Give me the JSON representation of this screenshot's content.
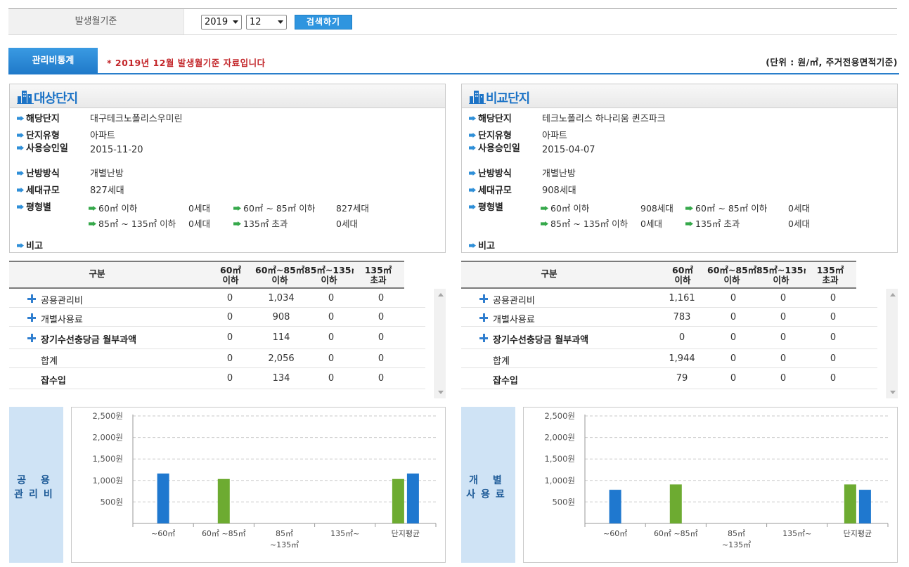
{
  "search": {
    "label": "발생월기준",
    "year": "2019",
    "month": "12",
    "button_label": "검색하기"
  },
  "stats": {
    "tab_label": "관리비통계",
    "notice": "* 2019년 12월 발생월기준 자료입니다",
    "unit": "(단위 : 원/㎡, 주거전용면적기준)"
  },
  "colors": {
    "accent": "#2f95df",
    "notice": "#c3262a",
    "bar_blue": "#1f78cf",
    "bar_green": "#6dab31"
  },
  "target": {
    "title": "대상단지",
    "rows": [
      {
        "key": "해당단지",
        "value": "대구테크노폴리스우미린"
      },
      {
        "key": "단지유형",
        "value": "아파트"
      },
      {
        "key": "사용승인일",
        "value": "2015-11-20"
      },
      {
        "key": "난방방식",
        "value": "개별난방"
      },
      {
        "key": "세대규모",
        "value": "827세대"
      }
    ],
    "size_key": "평형별",
    "sizes": [
      {
        "label": "60㎡ 이하",
        "count": "0세대"
      },
      {
        "label": "60㎡ ~ 85㎡ 이하",
        "count": "827세대"
      },
      {
        "label": "85㎡ ~ 135㎡ 이하",
        "count": "0세대"
      },
      {
        "label": "135㎡ 초과",
        "count": "0세대"
      }
    ],
    "note_key": "비고",
    "table": {
      "headers": [
        "구분",
        "60㎡\n이하",
        "60㎡~85㎡\n이하",
        "85㎡~135㎡\n이하",
        "135㎡\n초과"
      ],
      "rows": [
        {
          "label": "공용관리비",
          "plus": true,
          "values": [
            "0",
            "1,034",
            "0",
            "0"
          ]
        },
        {
          "label": "개별사용료",
          "plus": true,
          "values": [
            "0",
            "908",
            "0",
            "0"
          ]
        },
        {
          "label": "장기수선충당금 월부과액",
          "plus": true,
          "values": [
            "0",
            "114",
            "0",
            "0"
          ]
        },
        {
          "label": "합계",
          "plus": false,
          "values": [
            "0",
            "2,056",
            "0",
            "0"
          ]
        },
        {
          "label": "잡수입",
          "plus": false,
          "values": [
            "0",
            "134",
            "0",
            "0"
          ]
        }
      ]
    }
  },
  "compare": {
    "title": "비교단지",
    "rows": [
      {
        "key": "해당단지",
        "value": "테크노폴리스 하나리움 퀸즈파크"
      },
      {
        "key": "단지유형",
        "value": "아파트"
      },
      {
        "key": "사용승인일",
        "value": "2015-04-07"
      },
      {
        "key": "난방방식",
        "value": "개별난방"
      },
      {
        "key": "세대규모",
        "value": "908세대"
      }
    ],
    "size_key": "평형별",
    "sizes": [
      {
        "label": "60㎡ 이하",
        "count": "908세대"
      },
      {
        "label": "60㎡ ~ 85㎡ 이하",
        "count": "0세대"
      },
      {
        "label": "85㎡ ~ 135㎡ 이하",
        "count": "0세대"
      },
      {
        "label": "135㎡ 초과",
        "count": "0세대"
      }
    ],
    "note_key": "비고",
    "table": {
      "headers": [
        "구분",
        "60㎡\n이하",
        "60㎡~85㎡\n이하",
        "85㎡~135㎡\n이하",
        "135㎡\n초과"
      ],
      "rows": [
        {
          "label": "공용관리비",
          "plus": true,
          "values": [
            "1,161",
            "0",
            "0",
            "0"
          ]
        },
        {
          "label": "개별사용료",
          "plus": true,
          "values": [
            "783",
            "0",
            "0",
            "0"
          ]
        },
        {
          "label": "장기수선충당금 월부과액",
          "plus": true,
          "values": [
            "0",
            "0",
            "0",
            "0"
          ]
        },
        {
          "label": "합계",
          "plus": false,
          "values": [
            "1,944",
            "0",
            "0",
            "0"
          ]
        },
        {
          "label": "잡수입",
          "plus": false,
          "values": [
            "79",
            "0",
            "0",
            "0"
          ]
        }
      ]
    }
  },
  "chart_data": [
    {
      "type": "bar",
      "side_label": [
        "공 용",
        "관리비"
      ],
      "categories": [
        "~60㎡",
        "60㎡ ~85㎡",
        "85㎡\n~135㎡",
        "135㎡~",
        "단지평균"
      ],
      "series": [
        {
          "color": "#1f78cf",
          "values": [
            1161,
            0,
            0,
            0,
            1161
          ]
        },
        {
          "color": "#6dab31",
          "values": [
            0,
            1034,
            0,
            0,
            1034
          ]
        }
      ],
      "yticks": [
        "500원",
        "1,000원",
        "1,500원",
        "2,000원",
        "2,500원"
      ],
      "ylim": [
        0,
        2500
      ],
      "grid": true
    },
    {
      "type": "bar",
      "side_label": [
        "개 별",
        "사용료"
      ],
      "categories": [
        "~60㎡",
        "60㎡ ~85㎡",
        "85㎡\n~135㎡",
        "135㎡~",
        "단지평균"
      ],
      "series": [
        {
          "color": "#1f78cf",
          "values": [
            783,
            0,
            0,
            0,
            783
          ]
        },
        {
          "color": "#6dab31",
          "values": [
            0,
            908,
            0,
            0,
            908
          ]
        }
      ],
      "yticks": [
        "500원",
        "1,000원",
        "1,500원",
        "2,000원",
        "2,500원"
      ],
      "ylim": [
        0,
        2500
      ],
      "grid": true
    }
  ]
}
